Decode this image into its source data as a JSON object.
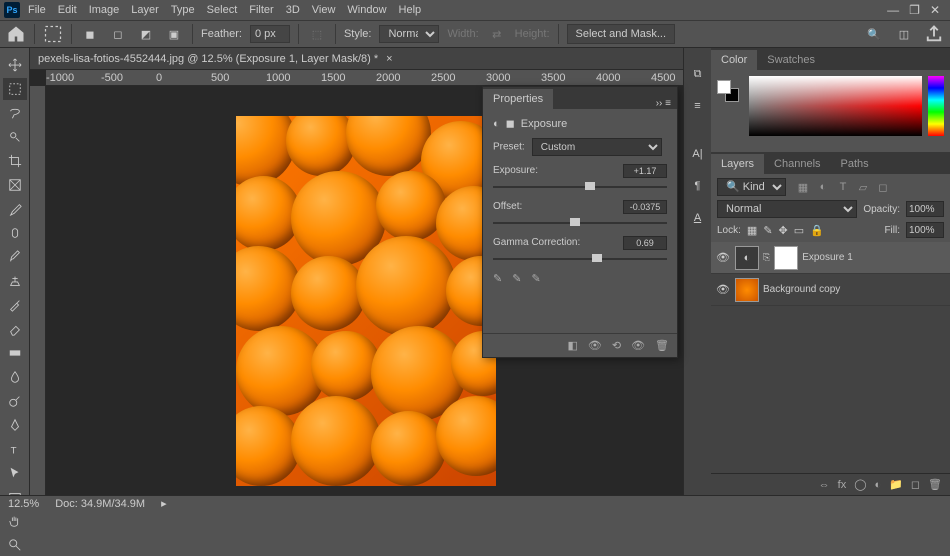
{
  "app": {
    "name": "Ps"
  },
  "menu": {
    "items": [
      "File",
      "Edit",
      "Image",
      "Layer",
      "Type",
      "Select",
      "Filter",
      "3D",
      "View",
      "Window",
      "Help"
    ]
  },
  "options": {
    "feather_label": "Feather:",
    "feather_value": "0 px",
    "style_label": "Style:",
    "style_value": "Normal",
    "width_label": "Width:",
    "height_label": "Height:",
    "select_mask": "Select and Mask..."
  },
  "document": {
    "tab": "pexels-lisa-fotios-4552444.jpg @ 12.5% (Exposure 1, Layer Mask/8) *",
    "ruler_marks": [
      "-1000",
      "-500",
      "0",
      "500",
      "1000",
      "1500",
      "2000",
      "2500",
      "3000",
      "3500",
      "4000",
      "4500"
    ]
  },
  "properties": {
    "panel_title": "Properties",
    "title": "Exposure",
    "preset_label": "Preset:",
    "preset_value": "Custom",
    "exposure_label": "Exposure:",
    "exposure_value": "+1.17",
    "offset_label": "Offset:",
    "offset_value": "-0.0375",
    "gamma_label": "Gamma Correction:",
    "gamma_value": "0.69"
  },
  "color_panel": {
    "tabs": [
      "Color",
      "Swatches"
    ]
  },
  "layers_panel": {
    "tabs": [
      "Layers",
      "Channels",
      "Paths"
    ],
    "kind_label": "Kind",
    "blend_mode": "Normal",
    "opacity_label": "Opacity:",
    "opacity_value": "100%",
    "lock_label": "Lock:",
    "fill_label": "Fill:",
    "fill_value": "100%",
    "layers": [
      {
        "name": "Exposure 1",
        "type": "adjustment",
        "selected": true
      },
      {
        "name": "Background copy",
        "type": "image",
        "selected": false
      }
    ]
  },
  "status": {
    "zoom": "12.5%",
    "doc_size": "Doc: 34.9M/34.9M"
  }
}
